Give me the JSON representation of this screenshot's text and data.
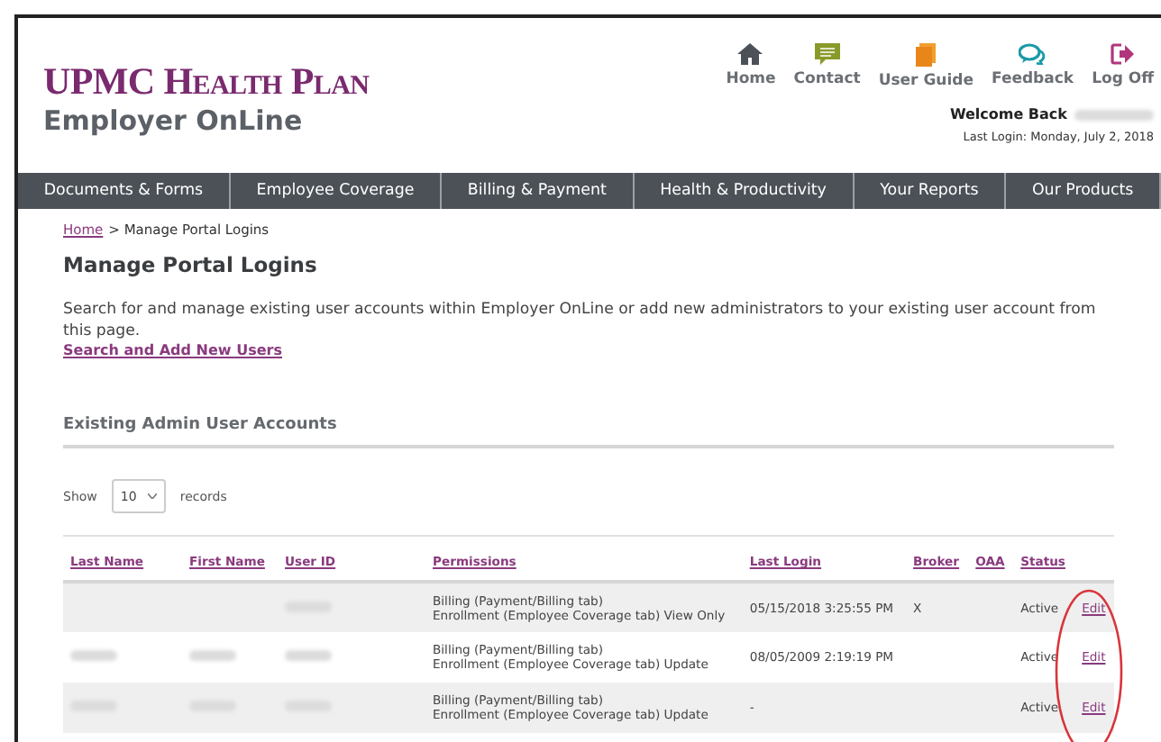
{
  "brand": {
    "title": "UPMC Health Plan",
    "subtitle": "Employer OnLine"
  },
  "top_links": [
    {
      "label": "Home"
    },
    {
      "label": "Contact"
    },
    {
      "label": "User Guide"
    },
    {
      "label": "Feedback"
    },
    {
      "label": "Log Off"
    }
  ],
  "welcome": {
    "label": "Welcome Back",
    "name_redacted": true,
    "last_login": "Last Login: Monday, July 2, 2018"
  },
  "nav": [
    "Documents & Forms",
    "Employee Coverage",
    "Billing & Payment",
    "Health & Productivity",
    "Your Reports",
    "Our Products"
  ],
  "breadcrumb": {
    "link": "Home",
    "current": "> Manage Portal Logins"
  },
  "title": "Manage Portal Logins",
  "intro": "Search for and manage existing user accounts within Employer OnLine or add new administrators to your existing user account from this page.",
  "add_link": "Search and Add New Users",
  "section_title": "Existing Admin User Accounts",
  "page_size": {
    "before": "Show",
    "value": "10",
    "after": "records"
  },
  "table": {
    "columns": [
      "Last Name",
      "First Name",
      "User ID",
      "Permissions",
      "Last Login",
      "Broker",
      "OAA",
      "Status"
    ],
    "rows": [
      {
        "user_id_blurred": true,
        "permissions": [
          "Billing (Payment/Billing tab)",
          "Enrollment (Employee Coverage tab) View Only"
        ],
        "last_login": "05/15/2018 3:25:55 PM",
        "broker": "X",
        "status": "Active",
        "action": "Edit"
      },
      {
        "last_name_blurred": true,
        "first_name_blurred": true,
        "user_id_blurred": true,
        "permissions": [
          "Billing (Payment/Billing tab)",
          "Enrollment (Employee Coverage tab) Update"
        ],
        "last_login": "08/05/2009 2:19:19 PM",
        "status": "Active",
        "action": "Edit"
      },
      {
        "last_name_blurred": true,
        "first_name_blurred": true,
        "user_id_blurred": true,
        "permissions": [
          "Billing (Payment/Billing tab)",
          "Enrollment (Employee Coverage tab) Update"
        ],
        "last_login": "-",
        "status": "Active",
        "action": "Edit"
      }
    ]
  },
  "annotation": {
    "kind": "circle",
    "color": "#d9343a"
  }
}
